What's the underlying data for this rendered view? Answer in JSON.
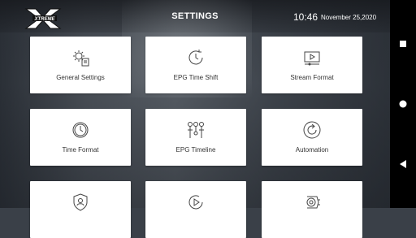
{
  "header": {
    "logo_text": "XTREME",
    "title": "SETTINGS",
    "time": "10:46",
    "date": "November 25,2020"
  },
  "tiles": [
    {
      "label": "General Settings",
      "icon": "gear-doc-icon"
    },
    {
      "label": "EPG Time Shift",
      "icon": "clock-arrow-icon"
    },
    {
      "label": "Stream Format",
      "icon": "monitor-play-icon"
    },
    {
      "label": "Time Format",
      "icon": "clock-icon"
    },
    {
      "label": "EPG Timeline",
      "icon": "timeline-icon"
    },
    {
      "label": "Automation",
      "icon": "refresh-icon"
    },
    {
      "label": "",
      "icon": "shield-user-icon"
    },
    {
      "label": "",
      "icon": "play-circle-icon"
    },
    {
      "label": "",
      "icon": "speaker-icon"
    }
  ]
}
